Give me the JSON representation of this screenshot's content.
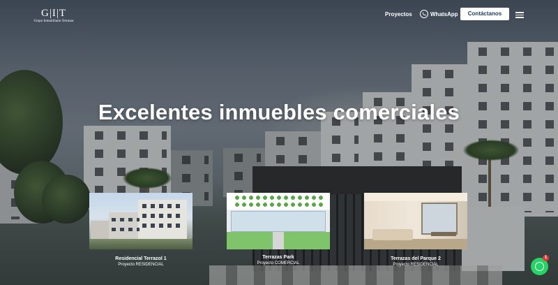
{
  "header": {
    "logo_mark": "G|I|T",
    "logo_subtitle": "Grupo Inmobiliario Terrazas",
    "nav_projects": "Proyectos",
    "nav_whatsapp": "WhatsApp",
    "cta_label": "Contáctanos",
    "menu_icon": "hamburger-menu-icon"
  },
  "hero": {
    "headline": "Excelentes inmuebles comerciales"
  },
  "projects": [
    {
      "title": "Residencial Terrazol 1",
      "subtitle": "Proyecto RESIDENCIAL"
    },
    {
      "title": "Terrazas Park",
      "subtitle": "Proyecto COMERCIAL"
    },
    {
      "title": "Terrazas del Parque 2",
      "subtitle": "Proyecto RESIDENCIAL"
    }
  ],
  "floating_whatsapp": {
    "badge_count": "1",
    "icon": "whatsapp-icon",
    "color": "#25d366"
  }
}
